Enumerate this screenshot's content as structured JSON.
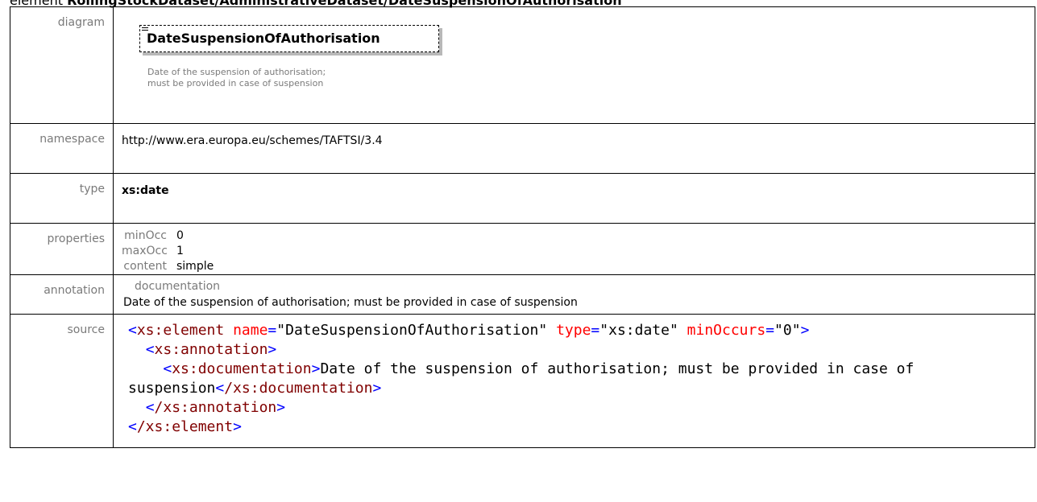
{
  "heading": {
    "kind": "element",
    "path": "RollingStockDataset/AdministrativeDataset/DateSuspensionOfAuthorisation"
  },
  "labels": {
    "diagram": "diagram",
    "namespace": "namespace",
    "type": "type",
    "properties": "properties",
    "annotation": "annotation",
    "source": "source"
  },
  "diagram": {
    "element_name": "DateSuspensionOfAuthorisation",
    "doc_line1": "Date of the suspension of authorisation;",
    "doc_line2": "must be provided in case of suspension"
  },
  "namespace": "http://www.era.europa.eu/schemes/TAFTSI/3.4",
  "type": "xs:date",
  "properties": [
    {
      "key": "minOcc",
      "value": "0"
    },
    {
      "key": "maxOcc",
      "value": "1"
    },
    {
      "key": "content",
      "value": "simple"
    }
  ],
  "annotation": {
    "title": "documentation",
    "text": "Date of the suspension of authorisation; must be provided in case of suspension"
  },
  "source": {
    "open_tag": "xs:element",
    "name_attr": "name",
    "name_val": "\"DateSuspensionOfAuthorisation\"",
    "type_attr": "type",
    "type_val": "\"xs:date\"",
    "minoccurs_attr": "minOccurs",
    "minoccurs_val": "\"0\"",
    "annotation_tag": "xs:annotation",
    "documentation_tag": "xs:documentation",
    "documentation_text": "Date of the suspension of authorisation; must be provided in case of suspension",
    "close_documentation": "/xs:documentation",
    "close_annotation": "/xs:annotation",
    "close_element": "/xs:element"
  }
}
